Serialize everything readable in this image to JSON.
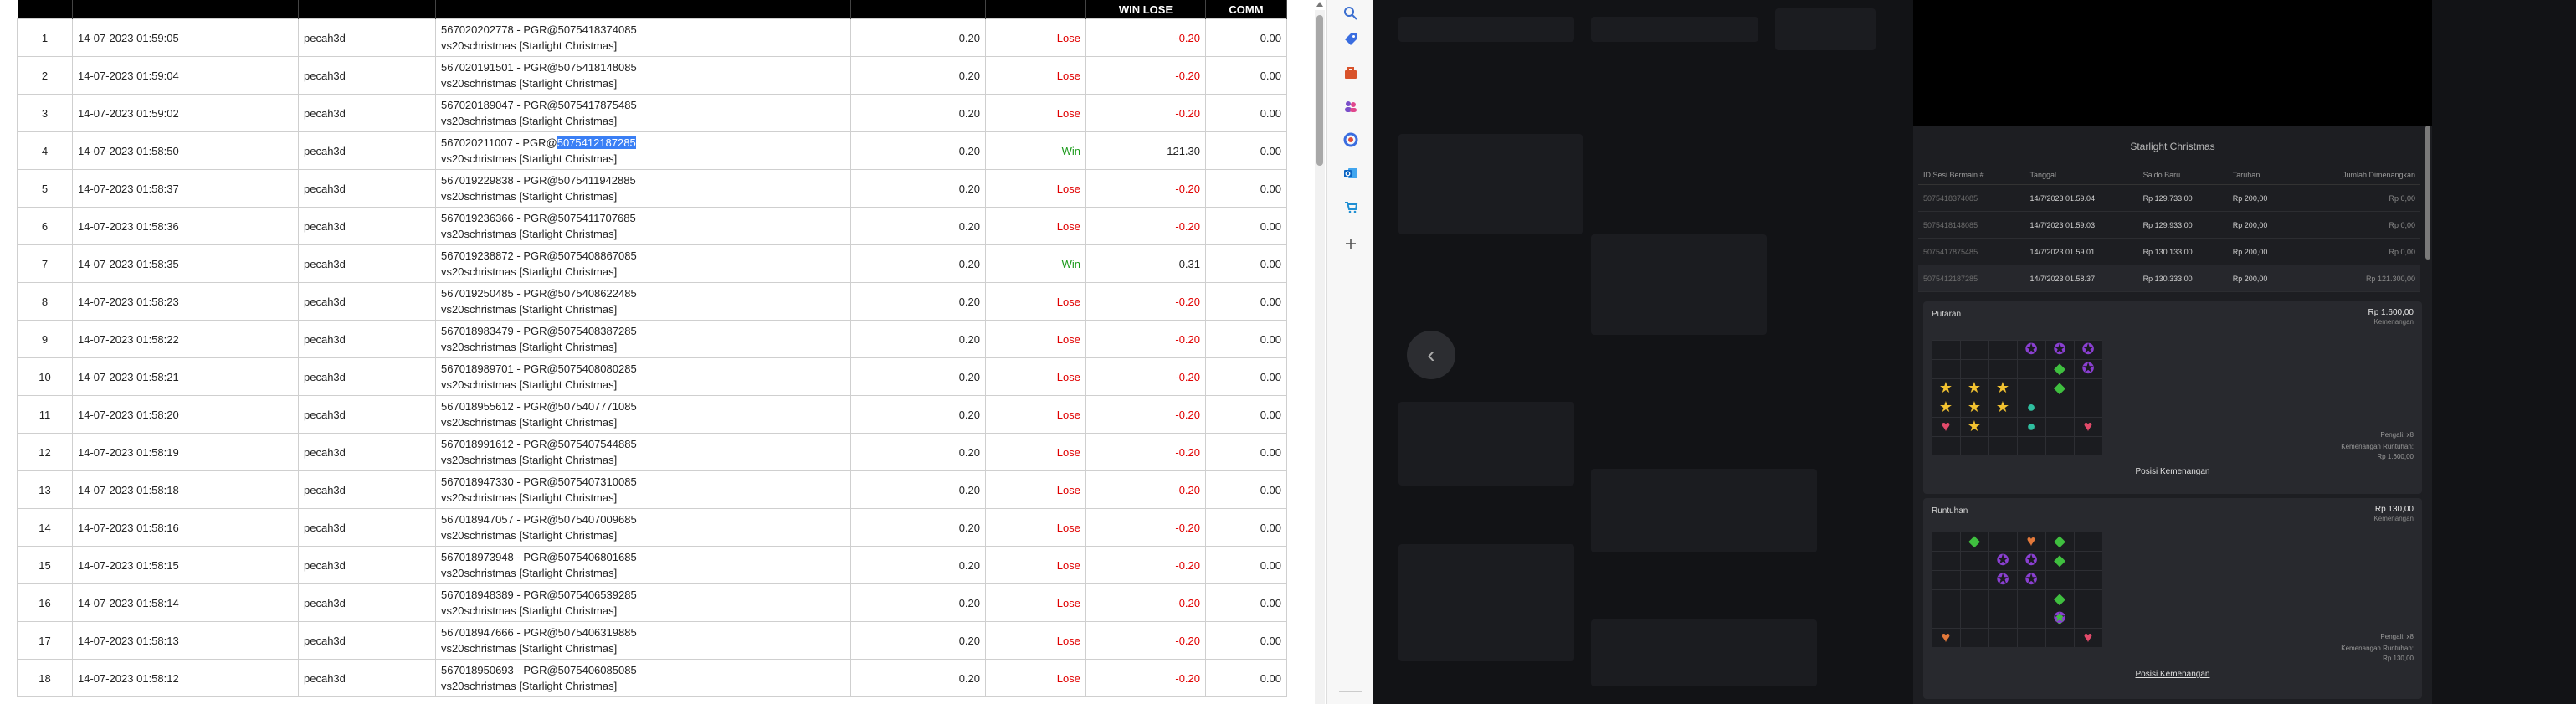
{
  "table": {
    "headers": {
      "win_lose": "WIN LOSE",
      "comm": "COMM"
    },
    "selected_text": "5075412187285",
    "rows": [
      {
        "no": "1",
        "date": "14-07-2023 01:59:05",
        "user": "pecah3d",
        "id_line": "567020202778 - PGR@5075418374085",
        "game_line": "vs20schristmas [Starlight Christmas]",
        "bet": "0.20",
        "result": "Lose",
        "winlose": "-0.20",
        "comm": "0.00"
      },
      {
        "no": "2",
        "date": "14-07-2023 01:59:04",
        "user": "pecah3d",
        "id_line": "567020191501 - PGR@5075418148085",
        "game_line": "vs20schristmas [Starlight Christmas]",
        "bet": "0.20",
        "result": "Lose",
        "winlose": "-0.20",
        "comm": "0.00"
      },
      {
        "no": "3",
        "date": "14-07-2023 01:59:02",
        "user": "pecah3d",
        "id_line": "567020189047 - PGR@5075417875485",
        "game_line": "vs20schristmas [Starlight Christmas]",
        "bet": "0.20",
        "result": "Lose",
        "winlose": "-0.20",
        "comm": "0.00"
      },
      {
        "no": "4",
        "date": "14-07-2023 01:58:50",
        "user": "pecah3d",
        "id_line": "567020211007 - PGR@",
        "game_line": "vs20schristmas [Starlight Christmas]",
        "bet": "0.20",
        "result": "Win",
        "winlose": "121.30",
        "comm": "0.00"
      },
      {
        "no": "5",
        "date": "14-07-2023 01:58:37",
        "user": "pecah3d",
        "id_line": "567019229838 - PGR@5075411942885",
        "game_line": "vs20schristmas [Starlight Christmas]",
        "bet": "0.20",
        "result": "Lose",
        "winlose": "-0.20",
        "comm": "0.00"
      },
      {
        "no": "6",
        "date": "14-07-2023 01:58:36",
        "user": "pecah3d",
        "id_line": "567019236366 - PGR@5075411707685",
        "game_line": "vs20schristmas [Starlight Christmas]",
        "bet": "0.20",
        "result": "Lose",
        "winlose": "-0.20",
        "comm": "0.00"
      },
      {
        "no": "7",
        "date": "14-07-2023 01:58:35",
        "user": "pecah3d",
        "id_line": "567019238872 - PGR@5075408867085",
        "game_line": "vs20schristmas [Starlight Christmas]",
        "bet": "0.20",
        "result": "Win",
        "winlose": "0.31",
        "comm": "0.00"
      },
      {
        "no": "8",
        "date": "14-07-2023 01:58:23",
        "user": "pecah3d",
        "id_line": "567019250485 - PGR@5075408622485",
        "game_line": "vs20schristmas [Starlight Christmas]",
        "bet": "0.20",
        "result": "Lose",
        "winlose": "-0.20",
        "comm": "0.00"
      },
      {
        "no": "9",
        "date": "14-07-2023 01:58:22",
        "user": "pecah3d",
        "id_line": "567018983479 - PGR@5075408387285",
        "game_line": "vs20schristmas [Starlight Christmas]",
        "bet": "0.20",
        "result": "Lose",
        "winlose": "-0.20",
        "comm": "0.00"
      },
      {
        "no": "10",
        "date": "14-07-2023 01:58:21",
        "user": "pecah3d",
        "id_line": "567018989701 - PGR@5075408080285",
        "game_line": "vs20schristmas [Starlight Christmas]",
        "bet": "0.20",
        "result": "Lose",
        "winlose": "-0.20",
        "comm": "0.00"
      },
      {
        "no": "11",
        "date": "14-07-2023 01:58:20",
        "user": "pecah3d",
        "id_line": "567018955612 - PGR@5075407771085",
        "game_line": "vs20schristmas [Starlight Christmas]",
        "bet": "0.20",
        "result": "Lose",
        "winlose": "-0.20",
        "comm": "0.00"
      },
      {
        "no": "12",
        "date": "14-07-2023 01:58:19",
        "user": "pecah3d",
        "id_line": "567018991612 - PGR@5075407544885",
        "game_line": "vs20schristmas [Starlight Christmas]",
        "bet": "0.20",
        "result": "Lose",
        "winlose": "-0.20",
        "comm": "0.00"
      },
      {
        "no": "13",
        "date": "14-07-2023 01:58:18",
        "user": "pecah3d",
        "id_line": "567018947330 - PGR@5075407310085",
        "game_line": "vs20schristmas [Starlight Christmas]",
        "bet": "0.20",
        "result": "Lose",
        "winlose": "-0.20",
        "comm": "0.00"
      },
      {
        "no": "14",
        "date": "14-07-2023 01:58:16",
        "user": "pecah3d",
        "id_line": "567018947057 - PGR@5075407009685",
        "game_line": "vs20schristmas [Starlight Christmas]",
        "bet": "0.20",
        "result": "Lose",
        "winlose": "-0.20",
        "comm": "0.00"
      },
      {
        "no": "15",
        "date": "14-07-2023 01:58:15",
        "user": "pecah3d",
        "id_line": "567018973948 - PGR@5075406801685",
        "game_line": "vs20schristmas [Starlight Christmas]",
        "bet": "0.20",
        "result": "Lose",
        "winlose": "-0.20",
        "comm": "0.00"
      },
      {
        "no": "16",
        "date": "14-07-2023 01:58:14",
        "user": "pecah3d",
        "id_line": "567018948389 - PGR@5075406539285",
        "game_line": "vs20schristmas [Starlight Christmas]",
        "bet": "0.20",
        "result": "Lose",
        "winlose": "-0.20",
        "comm": "0.00"
      },
      {
        "no": "17",
        "date": "14-07-2023 01:58:13",
        "user": "pecah3d",
        "id_line": "567018947666 - PGR@5075406319885",
        "game_line": "vs20schristmas [Starlight Christmas]",
        "bet": "0.20",
        "result": "Lose",
        "winlose": "-0.20",
        "comm": "0.00"
      },
      {
        "no": "18",
        "date": "14-07-2023 01:58:12",
        "user": "pecah3d",
        "id_line": "567018950693 - PGR@5075406085085",
        "game_line": "vs20schristmas [Starlight Christmas]",
        "bet": "0.20",
        "result": "Lose",
        "winlose": "-0.20",
        "comm": "0.00"
      }
    ]
  },
  "sidebar_icons": [
    "search-icon",
    "tag-icon",
    "toolbox-icon",
    "people-icon",
    "office-icon",
    "outlook-icon",
    "shopping-icon",
    "add-icon"
  ],
  "game_panel": {
    "title": "Starlight Christmas",
    "headers": [
      "ID Sesi Bermain #",
      "Tanggal",
      "Saldo Baru",
      "Taruhan",
      "Jumlah Dimenangkan"
    ],
    "rows": [
      {
        "id": "5075418374085",
        "date": "14/7/2023 01.59.04",
        "saldo": "Rp 129.733,00",
        "bet": "Rp 200,00",
        "won": "Rp 0,00"
      },
      {
        "id": "5075418148085",
        "date": "14/7/2023 01.59.03",
        "saldo": "Rp 129.933,00",
        "bet": "Rp 200,00",
        "won": "Rp 0,00"
      },
      {
        "id": "5075417875485",
        "date": "14/7/2023 01.59.01",
        "saldo": "Rp 130.133,00",
        "bet": "Rp 200,00",
        "won": "Rp 0,00"
      },
      {
        "id": "5075412187285",
        "date": "14/7/2023 01.58.37",
        "saldo": "Rp 130.333,00",
        "bet": "Rp 200,00",
        "won": "Rp 121.300,00"
      }
    ],
    "spin": {
      "title": "Putaran",
      "amount": "Rp 1.600,00",
      "amount_sub": "Kemenangan",
      "pay_line1": "Pengali: x8",
      "pay_line2": "Kemenangan Runtuhan:",
      "pay_line3": "Rp 1.600,00",
      "link": "Posisi Kemenangan"
    },
    "tumble": {
      "title": "Runtuhan",
      "amount": "Rp 130,00",
      "amount_sub": "Kemenangan",
      "pay_line1": "Pengali: x8",
      "pay_line2": "Kemenangan Runtuhan:",
      "pay_line3": "Rp 130,00",
      "link": "Posisi Kemenangan"
    }
  },
  "colors": {
    "lose": "#e00000",
    "win": "#1a9a1a",
    "selection": "#3a7ff5",
    "panel_bg": "#1d1e22"
  }
}
